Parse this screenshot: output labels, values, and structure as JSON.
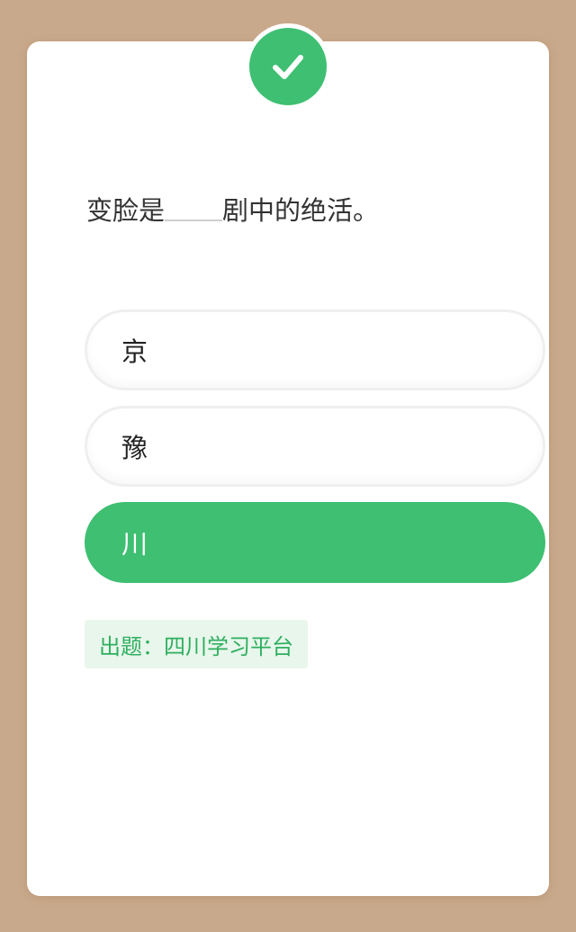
{
  "quiz": {
    "status_icon": "checkmark-icon",
    "question_before": "变脸是",
    "question_after": "剧中的绝活。",
    "options": [
      {
        "label": "京",
        "state": "normal"
      },
      {
        "label": "豫",
        "state": "normal"
      },
      {
        "label": "川",
        "state": "selected"
      }
    ],
    "source_label": "出题：四川学习平台"
  },
  "colors": {
    "background": "#c9a98b",
    "card": "#ffffff",
    "accent_green": "#3ebf72",
    "tag_background": "#e8f6ec",
    "tag_text": "#2faf5e",
    "question_text": "#333333"
  }
}
